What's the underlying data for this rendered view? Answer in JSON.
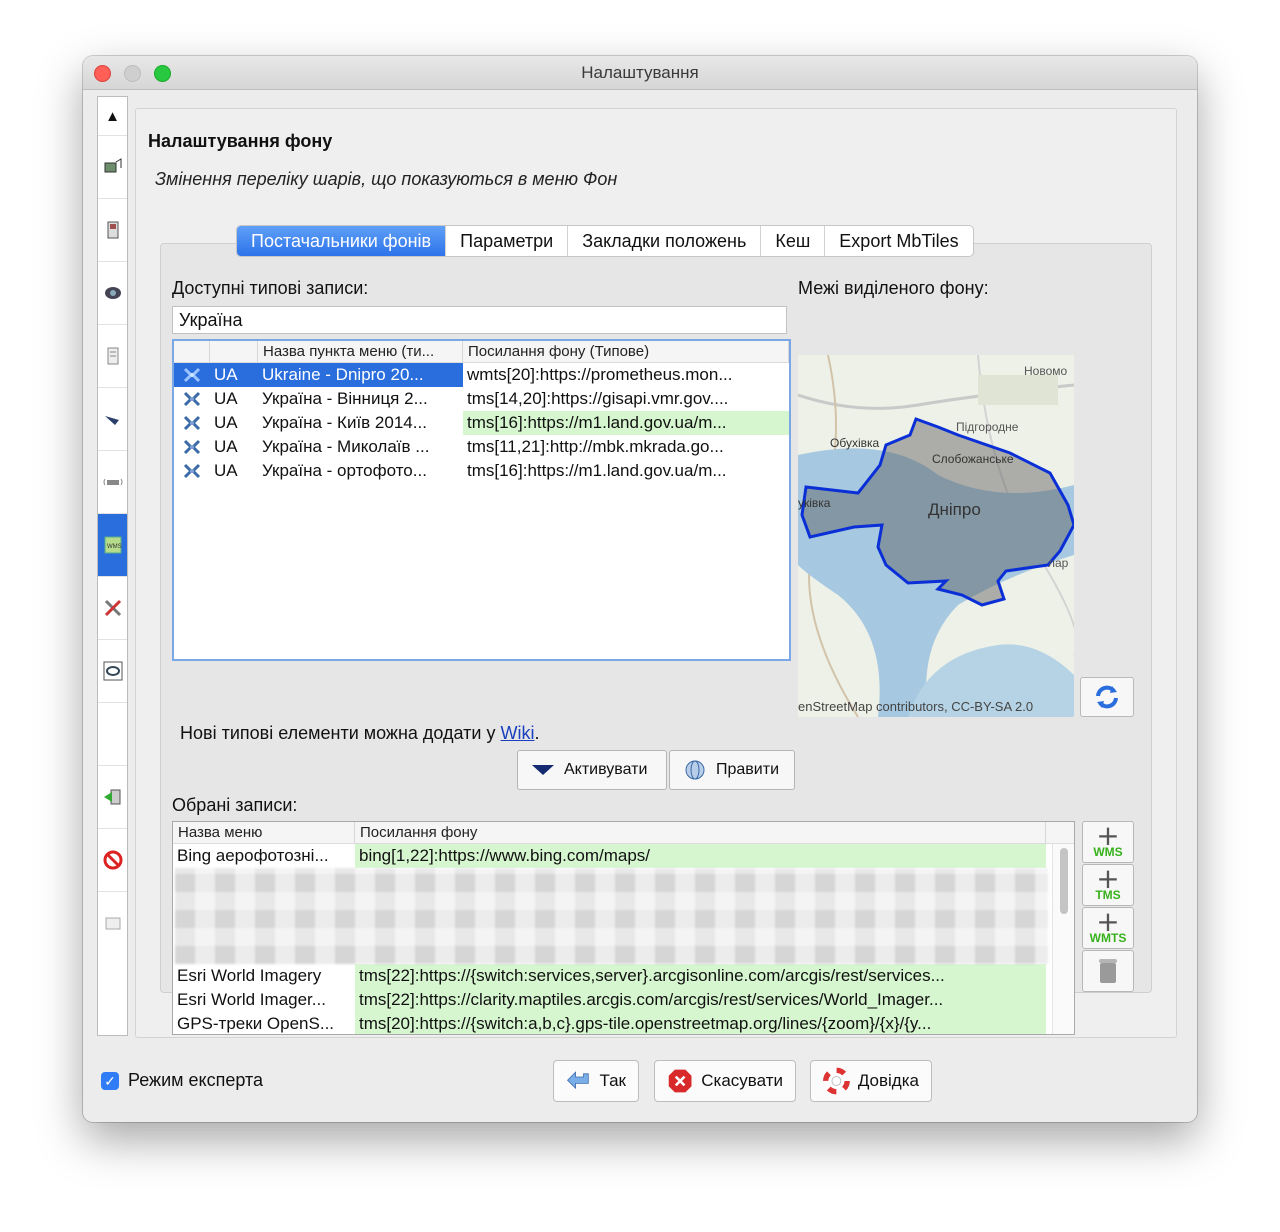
{
  "window": {
    "title": "Налаштування"
  },
  "section": {
    "title": "Налаштування фону",
    "subtitle": "Змінення переліку шарів, що показуються в меню Фон"
  },
  "tabs": [
    {
      "label": "Постачальники фонів",
      "active": true
    },
    {
      "label": "Параметри",
      "active": false
    },
    {
      "label": "Закладки положень",
      "active": false
    },
    {
      "label": "Кеш",
      "active": false
    },
    {
      "label": "Export MbTiles",
      "active": false
    }
  ],
  "available": {
    "label": "Доступні типові записи:",
    "filter_value": "Україна",
    "columns": [
      "",
      "",
      "Назва пункта меню (ти...",
      "Посилання фону (Типове)"
    ],
    "rows": [
      {
        "country": "UA",
        "name": "Ukraine - Dnipro 20...",
        "url": "wmts[20]:https://prometheus.mon...",
        "selected": true,
        "highlight": false
      },
      {
        "country": "UA",
        "name": "Україна - Вінниця 2...",
        "url": "tms[14,20]:https://gisapi.vmr.gov....",
        "selected": false,
        "highlight": false
      },
      {
        "country": "UA",
        "name": "Україна - Київ 2014...",
        "url": "tms[16]:https://m1.land.gov.ua/m...",
        "selected": false,
        "highlight": true
      },
      {
        "country": "UA",
        "name": "Україна - Миколаїв ...",
        "url": "tms[11,21]:http://mbk.mkrada.go...",
        "selected": false,
        "highlight": false
      },
      {
        "country": "UA",
        "name": "Україна - ортофото...",
        "url": "tms[16]:https://m1.land.gov.ua/m...",
        "selected": false,
        "highlight": false
      }
    ]
  },
  "bounds": {
    "label": "Межі виділеного фону:",
    "map_labels": [
      "Новомо",
      "Підгородне",
      "Обухівка",
      "Слобожанське",
      "уківка",
      "Дніпро",
      "лар"
    ],
    "attribution": "enStreetMap contributors, CC-BY-SA 2.0"
  },
  "wiki": {
    "text": "Нові типові елементи можна додати у ",
    "link": "Wiki",
    "suffix": "."
  },
  "actions": {
    "activate": "Активувати",
    "edit": "Правити"
  },
  "chosen": {
    "label": "Обрані записи:",
    "columns": [
      "Назва меню",
      "Посилання фону"
    ],
    "rows_top": [
      {
        "name": "Bing аерофотозні...",
        "url": "bing[1,22]:https://www.bing.com/maps/"
      }
    ],
    "rows_bottom": [
      {
        "name": "Esri World Imagery",
        "url": "tms[22]:https://{switch:services,server}.arcgisonline.com/arcgis/rest/services..."
      },
      {
        "name": "Esri World Imager...",
        "url": "tms[22]:https://clarity.maptiles.arcgis.com/arcgis/rest/services/World_Imager..."
      },
      {
        "name": "GPS-треки OpenS...",
        "url": "tms[20]:https://{switch:a,b,c}.gps-tile.openstreetmap.org/lines/{zoom}/{x}/{y..."
      }
    ],
    "side_buttons": [
      "WMS",
      "TMS",
      "WMTS"
    ]
  },
  "footer": {
    "expert_label": "Режим експерта",
    "expert_checked": true,
    "ok": "Так",
    "cancel": "Скасувати",
    "help": "Довідка"
  },
  "sidebar_icons": [
    "display-icon",
    "phone-icon",
    "connection-icon",
    "plugin-icon",
    "pen-icon",
    "remote-icon",
    "imagery-icon",
    "tools-icon",
    "map-style-icon",
    "empty-icon",
    "shortcut-icon",
    "validator-icon",
    "advanced-icon"
  ],
  "colors": {
    "selection": "#2a6ede",
    "highlight": "#d6f6cf",
    "link": "#1a3fbf",
    "bounds": "#0b2fd6"
  }
}
